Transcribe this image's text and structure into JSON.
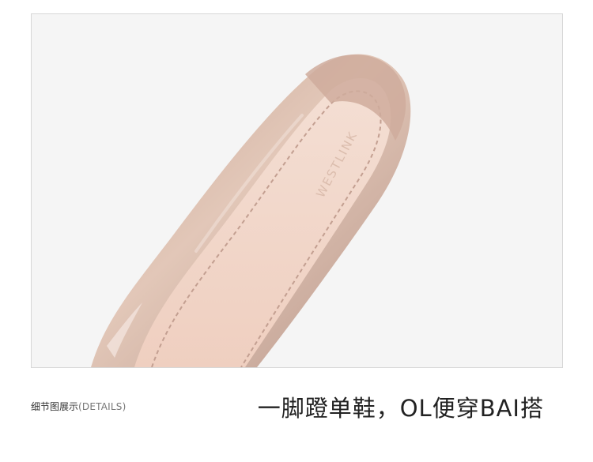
{
  "photo": {
    "brand_text": "WESTLINK",
    "colors": {
      "background": "#f5f5f5",
      "patent_leather": "#d8b8a6",
      "insole": "#f0d4c7",
      "stitching": "#c39f91"
    }
  },
  "caption": {
    "details_cn": "细节图展示",
    "details_en": "(DETAILS)",
    "headline": "一脚蹬单鞋，OL便穿BAI搭"
  }
}
